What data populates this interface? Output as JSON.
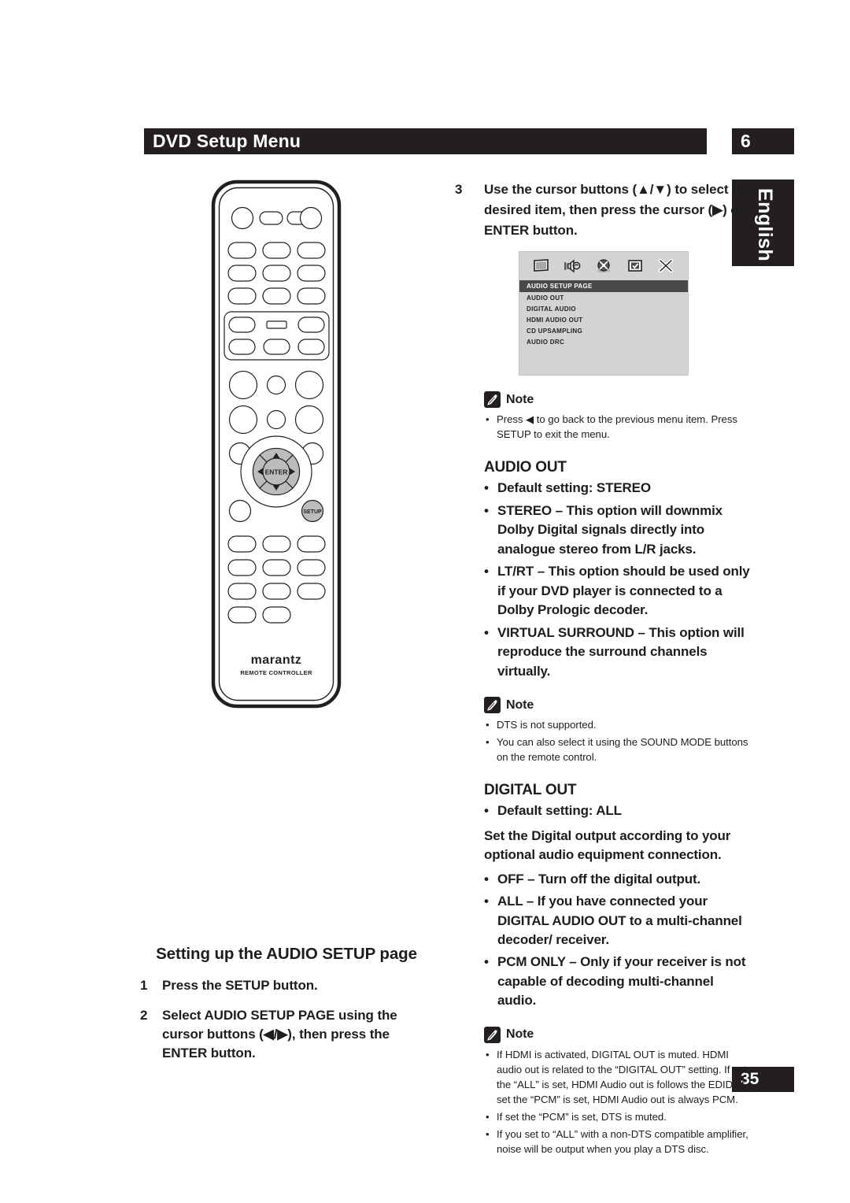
{
  "header": {
    "title": "DVD Setup Menu",
    "chapter": "6",
    "language_tab": "English",
    "page_number": "35"
  },
  "remote": {
    "brand": "marantz",
    "subtitle": "REMOTE CONTROLLER",
    "enter_label": "ENTER",
    "setup_label": "SETUP"
  },
  "left_column": {
    "heading": "Setting up the AUDIO SETUP page",
    "steps": [
      {
        "num": "1",
        "text": "Press the SETUP button."
      },
      {
        "num": "2",
        "text": "Select AUDIO SETUP PAGE using the cursor buttons (◀/▶), then press the ENTER button."
      }
    ]
  },
  "right_column": {
    "step3": {
      "num": "3",
      "text": "Use the cursor buttons (▲/▼) to select the desired item, then press the cursor (▶) or ENTER button."
    },
    "osd": {
      "icons": [
        "tv-monitor-icon",
        "speaker-audio-icon",
        "disc-video-icon",
        "preference-check-icon",
        "exit-x-icon"
      ],
      "title": "AUDIO SETUP PAGE",
      "items": [
        "AUDIO OUT",
        "DIGITAL AUDIO",
        "HDMI AUDIO OUT",
        "CD UPSAMPLING",
        "AUDIO DRC"
      ]
    },
    "note1": {
      "label": "Note",
      "items": [
        "Press ◀ to go back to the previous menu item. Press SETUP to exit the menu."
      ]
    },
    "audio_out": {
      "heading": "AUDIO OUT",
      "options": [
        "Default setting: STEREO",
        "STEREO – This option will downmix Dolby Digital signals directly into analogue stereo from L/R jacks.",
        "LT/RT – This option should be used only if your DVD player is connected to a Dolby Prologic decoder.",
        "VIRTUAL SURROUND – This option will reproduce the surround channels virtually."
      ]
    },
    "note2": {
      "label": "Note",
      "items": [
        "DTS is not supported.",
        "You can also select it using the SOUND MODE buttons on the remote control."
      ]
    },
    "digital_out": {
      "heading": "DIGITAL OUT",
      "default_option": "Default setting: ALL",
      "paragraph": "Set the Digital output according to your optional audio equipment connection.",
      "options": [
        "OFF – Turn off the digital output.",
        "ALL – If you have connected your DIGITAL AUDIO OUT to a multi-channel decoder/ receiver.",
        "PCM ONLY – Only if your receiver is not capable of decoding multi-channel audio."
      ]
    },
    "note3": {
      "label": "Note",
      "items": [
        "If HDMI is activated, DIGITAL OUT is muted. HDMI audio out is related to the “DIGITAL OUT” setting. If set the “ALL” is set, HDMI Audio out is follows the EDID. If set the “PCM” is set, HDMI Audio out is always PCM.",
        "If set the “PCM” is set, DTS is muted.",
        "If you set to “ALL” with a non-DTS compatible amplifier, noise will be output when you play a DTS disc."
      ]
    }
  },
  "colors": {
    "ink": "#231f20",
    "osd_background": "#d2d3d4",
    "osd_highlight": "#4a4a4c",
    "remote_button_fill": "#bcbcbc"
  }
}
